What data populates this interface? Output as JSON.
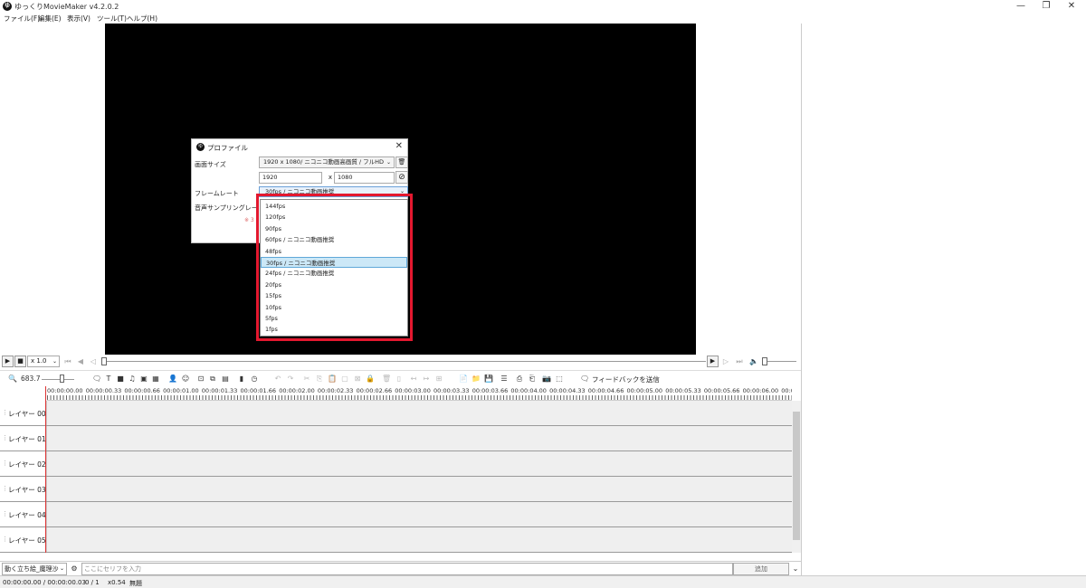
{
  "app": {
    "title": "ゆっくりMovieMaker v4.2.0.2",
    "logo_glyph": "ゆ",
    "window_controls": [
      "—",
      "❐",
      "✕"
    ]
  },
  "menu": [
    "ファイル(F)",
    "編集(E)",
    "表示(V)",
    "ツール(T)",
    "ヘルプ(H)"
  ],
  "playback": {
    "speed": "x 1.0"
  },
  "toolbar": {
    "zoom_value": "683.7",
    "feedback_label": "フィードバックを送信"
  },
  "timeline": {
    "ticks": [
      "00:00:00.00",
      "00:00:00.33",
      "00:00:00.66",
      "00:00:01.00",
      "00:00:01.33",
      "00:00:01.66",
      "00:00:02.00",
      "00:00:02.33",
      "00:00:02.66",
      "00:00:03.00",
      "00:00:03.33",
      "00:00:03.66",
      "00:00:04.00",
      "00:00:04.33",
      "00:00:04.66",
      "00:00:05.00",
      "00:00:05.33",
      "00:00:05.66",
      "00:00:06.00",
      "00:00:0"
    ],
    "layers": [
      "レイヤー 00",
      "レイヤー 01",
      "レイヤー 02",
      "レイヤー 03",
      "レイヤー 04",
      "レイヤー 05"
    ]
  },
  "bottom": {
    "character": "動く立ち絵_魔理沙",
    "serif_placeholder": "ここにセリフを入力",
    "add_label": "追加"
  },
  "status": {
    "time": "00:00:00.00  /  00:00:00.03",
    "frames": "0  /  1",
    "zoom": "x0.54",
    "project": "無題"
  },
  "dialog": {
    "title": "プロファイル",
    "screen_size_label": "画面サイズ",
    "screen_size_value": "1920 x 1080/ ニコニコ動画高画質 / フルHD",
    "width": "1920",
    "x_label": "x",
    "height": "1080",
    "framerate_label": "フレームレート",
    "framerate_value": "30fps / ニコニコ動画推奨",
    "sampling_label": "音声サンプリングレート",
    "hint": "※ 3"
  },
  "fps_options": [
    "144fps",
    "120fps",
    "90fps",
    "60fps / ニコニコ動画推奨",
    "48fps",
    "30fps / ニコニコ動画推奨",
    "24fps / ニコニコ動画推奨",
    "20fps",
    "15fps",
    "10fps",
    "5fps",
    "1fps"
  ],
  "fps_selected_index": 5,
  "colors": {
    "highlight": "#e3182f",
    "selected_row": "#cce8f7",
    "playhead": "#dd3333"
  }
}
